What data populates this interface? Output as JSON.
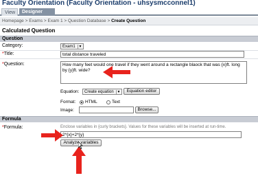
{
  "window": {
    "title": "Faculty Orientation  (Faculty Orientation - uhsysmcconnel1)"
  },
  "tabs": [
    {
      "label": "View"
    },
    {
      "label": "Designer Options"
    }
  ],
  "breadcrumb": {
    "items": [
      "Homepage",
      "Exams",
      "Exam 1",
      "Question Database"
    ],
    "separator": ">",
    "current": "Create Question"
  },
  "page": {
    "title": "Calculated Question"
  },
  "question_section": {
    "header": "Question",
    "category": {
      "label": "Category:",
      "value": "Exam1"
    },
    "title": {
      "required_mark": "*",
      "label": "Title:",
      "value": "total distance traveled"
    },
    "question": {
      "required_mark": "*",
      "label": "Question:",
      "value": "How many feet would one travel if they went around a rectangle blaock that was {x}ft. long by {y}ft. wide?"
    },
    "equation": {
      "label": "Equation:",
      "select_value": "Create equation",
      "button": "Equation editor"
    },
    "format": {
      "label": "Format:",
      "options": [
        "HTML",
        "Text"
      ],
      "selected": "HTML"
    },
    "image": {
      "label": "Image:",
      "value": "",
      "button": "Browse..."
    }
  },
  "formula_section": {
    "header": "Formula",
    "formula": {
      "required_mark": "*",
      "label": "Formula:",
      "hint": "Enclose variables in {curly brackets}. Values for these variables will be inserted at run-time.",
      "value": "2*{x}+2*{y}"
    },
    "analyze_button": "Analyze variables"
  },
  "colors": {
    "annotation_arrow": "#e8231d",
    "section_bg": "#c8ccd4",
    "tab_active": "#8492a3",
    "title_text": "#1a3c6b"
  },
  "icons": {
    "dropdown": "chevron-down-icon",
    "cursor": "pointer-cursor-icon"
  }
}
